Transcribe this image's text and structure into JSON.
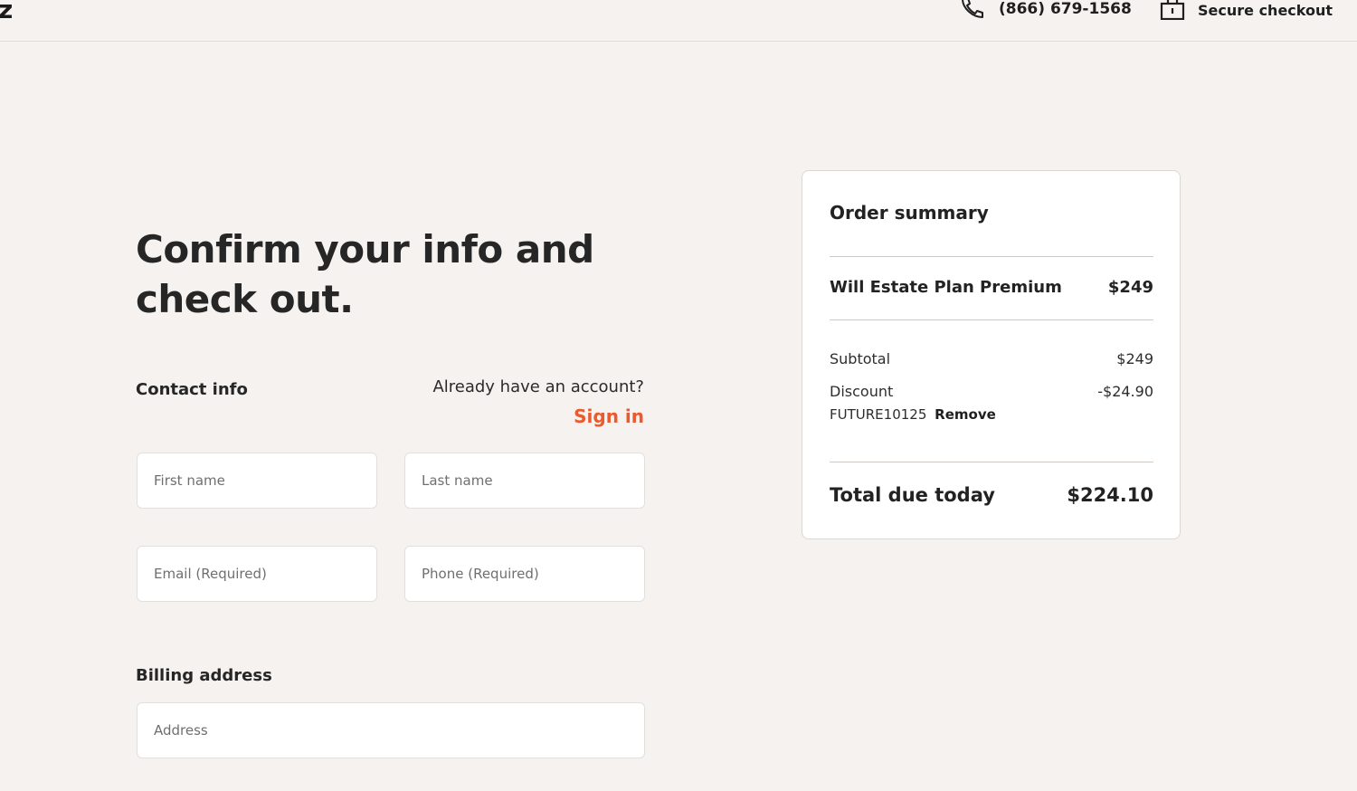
{
  "header": {
    "logo_text": "z",
    "phone_icon": "phone-icon",
    "phone_number": "(866) 679-1568",
    "secure_icon": "lock-icon",
    "secure_label": "Secure checkout"
  },
  "main": {
    "headline": "Confirm your info and check out.",
    "contact": {
      "title": "Contact info",
      "account_question": "Already have an account?",
      "sign_in_label": "Sign in",
      "fields": {
        "first_name": {
          "placeholder": "First name",
          "value": ""
        },
        "last_name": {
          "placeholder": "Last name",
          "value": ""
        },
        "email": {
          "placeholder": "Email (Required)",
          "value": ""
        },
        "phone": {
          "placeholder": "Phone (Required)",
          "value": ""
        }
      }
    },
    "billing": {
      "title": "Billing address",
      "address_placeholder": "Address"
    }
  },
  "summary": {
    "title": "Order summary",
    "product_name": "Will Estate Plan Premium",
    "product_price": "$249",
    "subtotal_label": "Subtotal",
    "subtotal_value": "$249",
    "discount_label": "Discount",
    "discount_value": "-$24.90",
    "promo_code": "FUTURE10125",
    "remove_label": "Remove",
    "total_label": "Total due today",
    "total_value": "$224.10"
  },
  "colors": {
    "background": "#f5f2ef",
    "accent": "#ea5a2e",
    "card": "#ffffff",
    "text": "#1f1f1f"
  }
}
